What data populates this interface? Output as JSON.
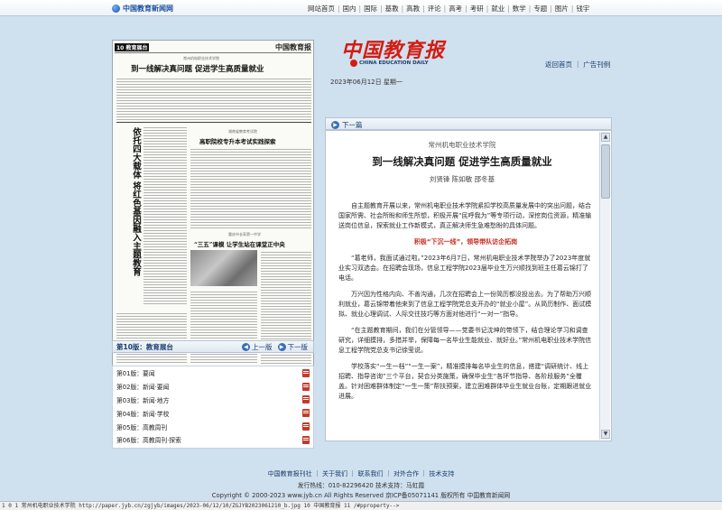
{
  "site": {
    "logo_text": "中国教育新闻网",
    "nav": [
      "网站首页",
      "国内",
      "国际",
      "基教",
      "高教",
      "评论",
      "高考",
      "考研",
      "就业",
      "数学",
      "专题",
      "图片",
      "钱宇"
    ]
  },
  "masthead": {
    "title": "中国教育报",
    "subtitle": "CHINA EDUCATION DAILY",
    "links": "返回首页 ｜ 广告刊例",
    "date": "2023年06月12日 星期一"
  },
  "paper": {
    "page_tag": "10 教育展台",
    "brand": "中国教育报",
    "kicker1": "常州机电职业技术学院",
    "headline1": "到一线解决真问题 促进学生高质量就业",
    "vertical_headline": "依托四大载体 将红色基因融入主题教育",
    "kicker2": "湖南省教育考试院",
    "headline2": "高职院校专升本考试实践探索",
    "kicker3": "重庆市长寿第一中学",
    "headline3": "“三五”课模 让学生站在课堂正中央"
  },
  "paper_nav": {
    "label": "第10版：教育展台",
    "prev": "上一版",
    "next": "下一版"
  },
  "page_list": [
    "第01版：要闻",
    "第02版：新闻·要闻",
    "第03版：新闻·地方",
    "第04版：新闻·学校",
    "第05版：高教周刊",
    "第06版：高教周刊·探索"
  ],
  "article": {
    "next_label": "下一篇",
    "kicker": "常州机电职业技术学院",
    "title": "到一线解决真问题 促进学生高质量就业",
    "authors": "刘贤锋 陈如敏 邵冬基",
    "p1": "自主题教育开展以来，常州机电职业技术学院紧扣学校高质量发展中的突出问题，结合国家所需、社会所盼和师生所想，积极开展“民呼我为”等专项行动，深挖岗位资源，精准输送岗位信息，探索就业工作新模式，真正解决师生急难愁盼的具体问题。",
    "subhead": "积极“下沉一线”，领导带队访企拓岗",
    "p2": "“葛老师，我面试通过啦。”2023年6月7日，常州机电职业技术学院举办了2023年度就业实习双选会。在招聘会现场，信息工程学院2023届毕业生万兴顺找到班主任葛云锦打了电话。",
    "p3": "万兴因为性格内向、不善沟通，几次在招聘会上一份简历都没投出去。为了帮助万兴顺利就业，葛云锦带着他来到了信息工程学院党总支开办的“就业小屋”。从简历制作、面试模拟、就业心理调试、人际交往技巧等方面对他进行“一对一”指导。",
    "p4": "“在主题教育期间，我们在分管领导——党委书记沈坤的带领下，结合理论学习和调查研究，详细摸排，多措并举，保障每一名毕业生能就业、就好业。”常州机电职业技术学院信息工程学院党总支书记徐莹说。",
    "p5": "学校落实“一生一档”“一生一案”，精准摸排每名毕业生的信息，搭建“调研统计、线上招聘、指导咨询”三个平台，契合分类施策，确保毕业生“各环节指导、各阶段服务”全覆盖。针对困难群体制定“一生一策”帮扶预案，建立困难群体毕业生就业台账，定期跟进就业进展。"
  },
  "footer": {
    "links": "中国教育报刊社 ｜ 关于我们 ｜ 联系我们 ｜ 对外合作 ｜ 技术支持",
    "hotline": "发行热线：010-82296420  技术支持：马虹霞",
    "copyright": "Copyright © 2000-2023 www.jyb.cn All Rights Reserved 京ICP备05071141 版权所有 中国教育新闻网"
  },
  "statusbar": "1 0 1 常州机电职业技术学院 http://paper.jyb.cn/zgjyb/images/2023-06/12/10/ZGJYB2023061210_b.jpg 10 中国教育报 11 /#pproperty-->"
}
